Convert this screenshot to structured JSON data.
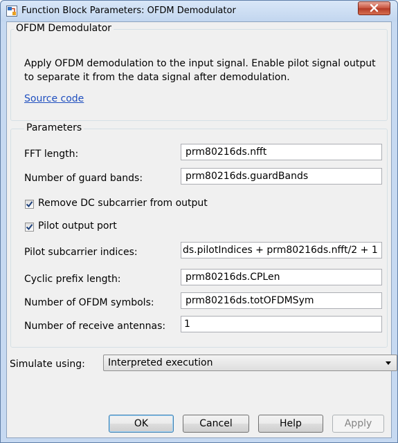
{
  "window": {
    "title": "Function Block Parameters: OFDM Demodulator"
  },
  "block": {
    "group_title": "OFDM Demodulator",
    "description": "Apply OFDM demodulation to the input signal. Enable pilot signal output to separate it from the data signal after demodulation.",
    "source_link": "Source code"
  },
  "parameters": {
    "group_title": "Parameters",
    "fft_length": {
      "label": "FFT length:",
      "value": "prm80216ds.nfft"
    },
    "guard_bands": {
      "label": "Number of guard bands:",
      "value": "prm80216ds.guardBands"
    },
    "remove_dc": {
      "label": "Remove DC subcarrier from output",
      "checked": true
    },
    "pilot_port": {
      "label": "Pilot output port",
      "checked": true
    },
    "pilot_indices": {
      "label": "Pilot subcarrier indices:",
      "value": "ds.pilotIndices + prm80216ds.nfft/2 + 1"
    },
    "cp_length": {
      "label": "Cyclic prefix length:",
      "value": "prm80216ds.CPLen"
    },
    "ofdm_symbols": {
      "label": "Number of OFDM symbols:",
      "value": "prm80216ds.totOFDMSym"
    },
    "rx_antennas": {
      "label": "Number of receive antennas:",
      "value": "1"
    }
  },
  "simulate": {
    "label": "Simulate using:",
    "selected": "Interpreted execution"
  },
  "buttons": {
    "ok": "OK",
    "cancel": "Cancel",
    "help": "Help",
    "apply": "Apply"
  },
  "colors": {
    "title_bar": "#c6d9f1",
    "client_bg": "#f0f0f0",
    "link": "#1f4fbf",
    "close_button": "#c7513c"
  },
  "icons": [
    "simulink-block-icon",
    "close-icon",
    "checkmark-icon",
    "chevron-down-icon"
  ]
}
